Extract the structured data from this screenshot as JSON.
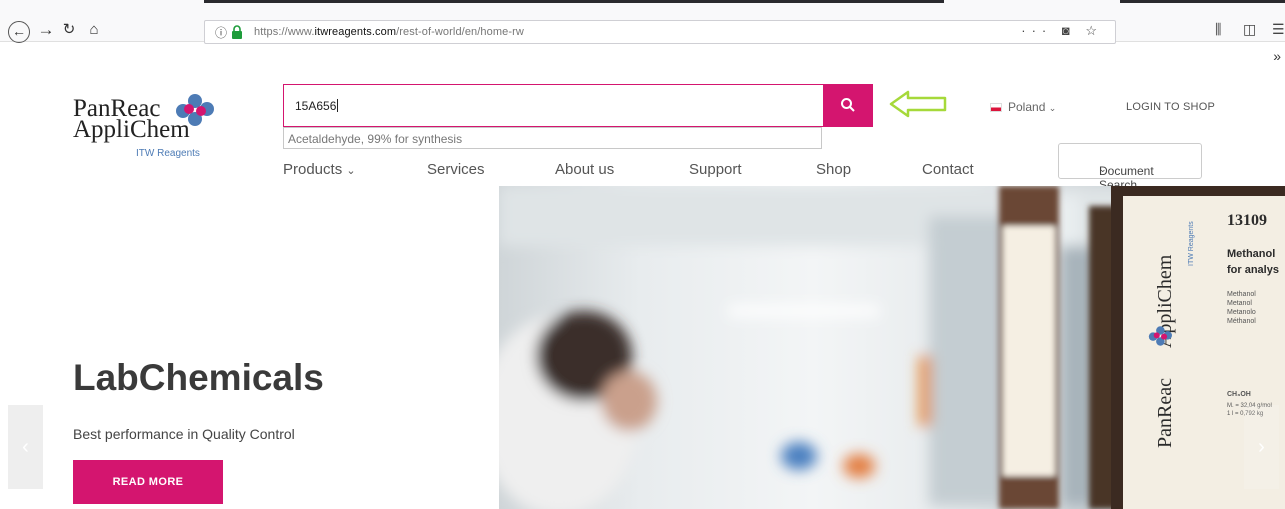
{
  "browser": {
    "info_icon": "info-icon",
    "url_prefix": "https://www.",
    "url_domain": "itwreagents.com",
    "url_path": "/rest-of-world/en/home-rw",
    "overflow": "»"
  },
  "header": {
    "logo_line1": "PanReac",
    "logo_line2": "AppliChem",
    "logo_tagline": "ITW Reagents",
    "search_value": "15A656",
    "suggestion": "Acetaldehyde, 99% for synthesis",
    "country": "Poland",
    "login": "LOGIN TO SHOP",
    "doc_search": "Document Search"
  },
  "nav": {
    "items": [
      {
        "label": "Products"
      },
      {
        "label": "Services"
      },
      {
        "label": "About us"
      },
      {
        "label": "Support"
      },
      {
        "label": "Shop"
      },
      {
        "label": "Contact"
      }
    ]
  },
  "hero": {
    "title": "LabChemicals",
    "subtitle": "Best performance in Quality Control",
    "button": "READ MORE",
    "label_brand1": "PanReac",
    "label_brand2": "AppliChem",
    "label_brand_tag": "ITW Reagents",
    "label_code": "13109",
    "label_name1": "Methanol",
    "label_name2": "for analys",
    "label_langs": [
      "Methanol",
      "Metanol",
      "Metanolo",
      "Méthanol"
    ],
    "label_formula": "CH₃OH",
    "label_props": [
      "M. = 32,04 g/mol",
      "1 l = 0,792 kg"
    ]
  },
  "colors": {
    "accent": "#d4156f",
    "arrow": "#a6d93a"
  }
}
